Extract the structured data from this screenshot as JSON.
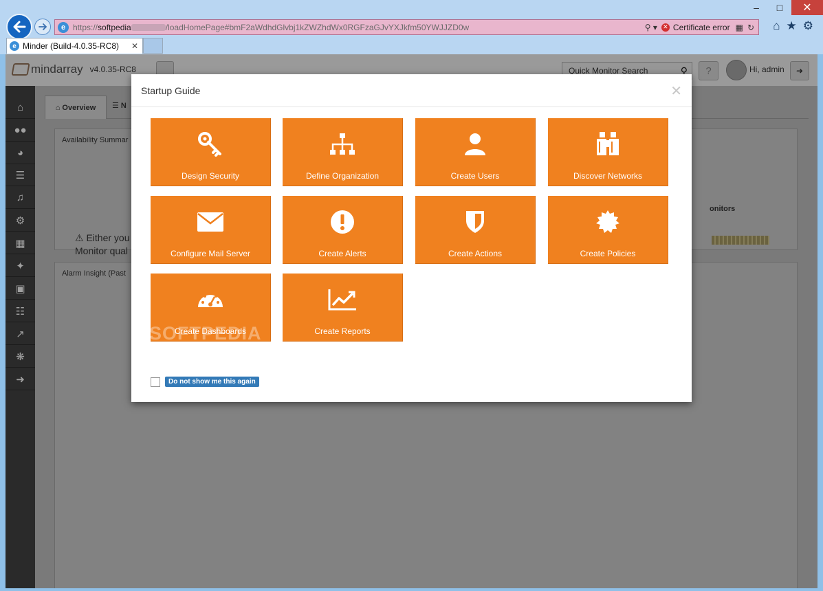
{
  "browser": {
    "url_host": "softpedia",
    "url_path": "/loadHomePage#bmF2aWdhdGlvbj1kZWZhdWx0RGFzaGJvYXJkfm50YWJJZD0w",
    "url_scheme": "https://",
    "cert_error": "Certificate error",
    "tab_title": "Minder (Build-4.0.35-RC8)",
    "tab_close": "✕"
  },
  "app": {
    "brand": "mindarray",
    "version": "v4.0.35-RC8",
    "quick_search_placeholder": "Quick Monitor Search",
    "greeting": "Hi, admin",
    "help_glyph": "?",
    "tabs": {
      "overview": "Overview"
    },
    "panels": {
      "availability": "Availability Summar",
      "alarm": "Alarm Insight (Past",
      "warning_line1": "Either you",
      "warning_line2": "Monitor qual",
      "monitors": "onitors"
    }
  },
  "modal": {
    "title": "Startup Guide",
    "close": "✕",
    "tiles": [
      {
        "label": "Design Security",
        "icon": "key-icon"
      },
      {
        "label": "Define Organization",
        "icon": "sitemap-icon"
      },
      {
        "label": "Create Users",
        "icon": "user-icon"
      },
      {
        "label": "Discover Networks",
        "icon": "binoculars-icon"
      },
      {
        "label": "Configure Mail Server",
        "icon": "envelope-icon"
      },
      {
        "label": "Create Alerts",
        "icon": "exclamation-icon"
      },
      {
        "label": "Create Actions",
        "icon": "shield-icon"
      },
      {
        "label": "Create Policies",
        "icon": "certificate-icon"
      },
      {
        "label": "Create Dashboards",
        "icon": "dashboard-icon"
      },
      {
        "label": "Create Reports",
        "icon": "line-chart-icon"
      }
    ],
    "dont_show_label": "Do not show me this again",
    "watermark": "SOFTPEDIA"
  },
  "colors": {
    "tile_orange": "#f0811f",
    "address_bar_error": "#e9b6cd",
    "button_blue": "#337ab7"
  }
}
